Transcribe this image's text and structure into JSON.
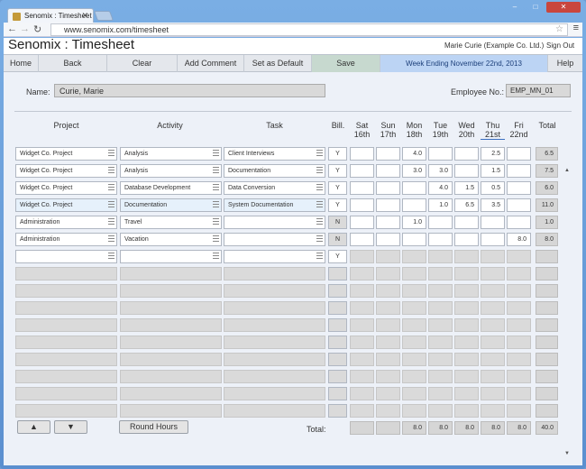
{
  "browser": {
    "tab_title": "Senomix : Timesheet",
    "url": "www.senomix.com/timesheet"
  },
  "app": {
    "title": "Senomix : Timesheet",
    "user": "Marie Curie  (Example Co. Ltd.)",
    "sign_out": "Sign Out"
  },
  "nav": {
    "home": "Home",
    "back": "Back",
    "clear": "Clear",
    "add_comment": "Add Comment",
    "set_default": "Set as Default",
    "save": "Save",
    "week": "Week Ending November 22nd, 2013",
    "help": "Help"
  },
  "employee": {
    "name_label": "Name:",
    "name": "Curie, Marie",
    "no_label": "Employee No.:",
    "no": "EMP_MN_01"
  },
  "headers": {
    "project": "Project",
    "activity": "Activity",
    "task": "Task",
    "bill": "Bill.",
    "total": "Total",
    "days": [
      {
        "d": "Sat",
        "n": "16th"
      },
      {
        "d": "Sun",
        "n": "17th"
      },
      {
        "d": "Mon",
        "n": "18th"
      },
      {
        "d": "Tue",
        "n": "19th"
      },
      {
        "d": "Wed",
        "n": "20th"
      },
      {
        "d": "Thu",
        "n": "21st"
      },
      {
        "d": "Fri",
        "n": "22nd"
      }
    ]
  },
  "rows": [
    {
      "project": "Widget Co. Project",
      "activity": "Analysis",
      "task": "Client Interviews",
      "bill": "Y",
      "hours": [
        "",
        "",
        "4.0",
        "",
        "",
        "2.5",
        ""
      ],
      "total": "6.5"
    },
    {
      "project": "Widget Co. Project",
      "activity": "Analysis",
      "task": "Documentation",
      "bill": "Y",
      "hours": [
        "",
        "",
        "3.0",
        "3.0",
        "",
        "1.5",
        ""
      ],
      "total": "7.5"
    },
    {
      "project": "Widget Co. Project",
      "activity": "Database Development",
      "task": "Data Conversion",
      "bill": "Y",
      "hours": [
        "",
        "",
        "",
        "4.0",
        "1.5",
        "0.5",
        ""
      ],
      "total": "6.0"
    },
    {
      "project": "Widget Co. Project",
      "activity": "Documentation",
      "task": "System Documentation",
      "bill": "Y",
      "hours": [
        "",
        "",
        "",
        "1.0",
        "6.5",
        "3.5",
        ""
      ],
      "total": "11.0"
    },
    {
      "project": "Administration",
      "activity": "Travel",
      "task": "",
      "bill": "N",
      "hours": [
        "",
        "",
        "1.0",
        "",
        "",
        "",
        ""
      ],
      "total": "1.0"
    },
    {
      "project": "Administration",
      "activity": "Vacation",
      "task": "",
      "bill": "N",
      "hours": [
        "",
        "",
        "",
        "",
        "",
        "",
        "8.0"
      ],
      "total": "8.0"
    },
    {
      "project": "",
      "activity": "",
      "task": "",
      "bill": "Y",
      "hours": [
        "",
        "",
        "",
        "",
        "",
        "",
        ""
      ],
      "total": ""
    }
  ],
  "footer": {
    "up": "▲",
    "down": "▼",
    "round": "Round Hours",
    "total_label": "Total:",
    "day_totals": [
      "",
      "",
      "8.0",
      "8.0",
      "8.0",
      "8.0",
      "8.0"
    ],
    "grand_total": "40.0"
  }
}
